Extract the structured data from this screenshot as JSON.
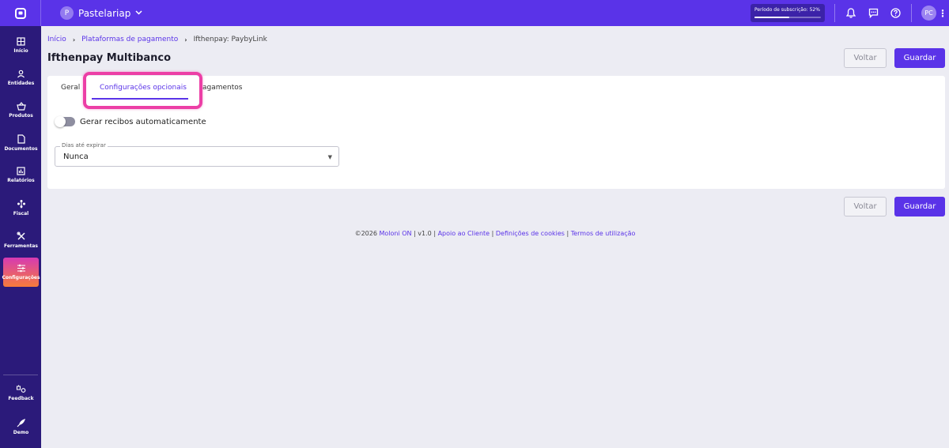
{
  "topbar": {
    "company_initial": "P",
    "company_name": "Pastelariap",
    "subscription_label": "Período de subscrição: 52%",
    "subscription_progress": 0.52,
    "user_initials": "PC"
  },
  "sidebar": {
    "items": [
      {
        "label": "Início"
      },
      {
        "label": "Entidades"
      },
      {
        "label": "Produtos"
      },
      {
        "label": "Documentos"
      },
      {
        "label": "Relatórios"
      },
      {
        "label": "Fiscal"
      },
      {
        "label": "Ferramentas"
      },
      {
        "label": "Configurações"
      }
    ],
    "bottom_items": [
      {
        "label": "Feedback"
      },
      {
        "label": "Demo"
      }
    ]
  },
  "breadcrumb": {
    "items": [
      "Início",
      "Plataformas de pagamento"
    ],
    "current": "Ifthenpay: PaybyLink"
  },
  "page": {
    "title": "Ifthenpay Multibanco",
    "back_label": "Voltar",
    "save_label": "Guardar"
  },
  "tabs": [
    {
      "label": "Geral"
    },
    {
      "label": "Configurações opcionais"
    },
    {
      "label": "agamentos"
    }
  ],
  "form": {
    "toggle_label": "Gerar recibos automaticamente",
    "toggle_on": false,
    "select_legend": "Dias até expirar",
    "select_value": "Nunca"
  },
  "footer": {
    "copyright": "©2026",
    "brand": "Moloni ON",
    "version": "v1.0",
    "links": [
      "Apoio ao Cliente",
      "Definições de cookies",
      "Termos de utilização"
    ]
  },
  "colors": {
    "accent": "#5a33e8",
    "sidebar": "#2b1a7a",
    "highlight": "#ec3fa6"
  }
}
